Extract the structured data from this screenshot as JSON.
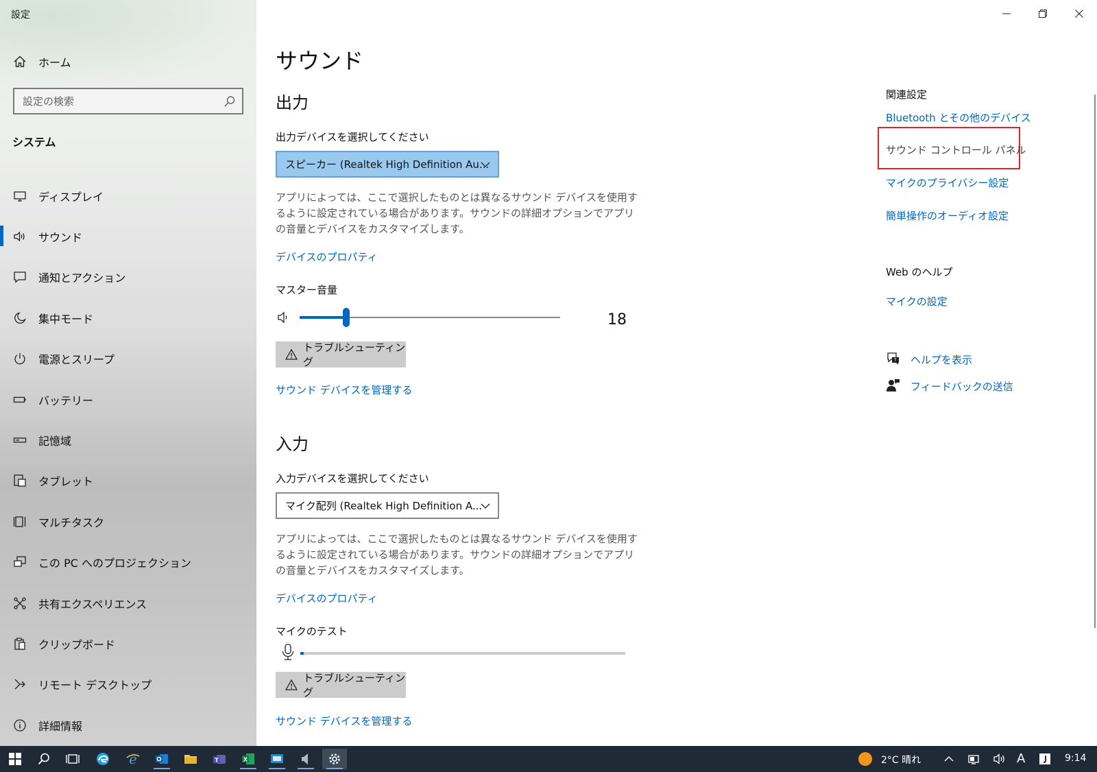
{
  "window": {
    "title": "設定"
  },
  "sidebar": {
    "home_label": "ホーム",
    "search_placeholder": "設定の検索",
    "section_title": "システム",
    "items": [
      {
        "label": "ディスプレイ",
        "icon": "display-icon"
      },
      {
        "label": "サウンド",
        "icon": "speaker-icon",
        "active": true
      },
      {
        "label": "通知とアクション",
        "icon": "notification-icon"
      },
      {
        "label": "集中モード",
        "icon": "moon-icon"
      },
      {
        "label": "電源とスリープ",
        "icon": "power-icon"
      },
      {
        "label": "バッテリー",
        "icon": "battery-icon"
      },
      {
        "label": "記憶域",
        "icon": "storage-icon"
      },
      {
        "label": "タブレット",
        "icon": "tablet-icon"
      },
      {
        "label": "マルチタスク",
        "icon": "multitask-icon"
      },
      {
        "label": "この PC へのプロジェクション",
        "icon": "projection-icon"
      },
      {
        "label": "共有エクスペリエンス",
        "icon": "share-icon"
      },
      {
        "label": "クリップボード",
        "icon": "clipboard-icon"
      },
      {
        "label": "リモート デスクトップ",
        "icon": "remote-desktop-icon"
      },
      {
        "label": "詳細情報",
        "icon": "info-icon"
      }
    ]
  },
  "main": {
    "title": "サウンド",
    "output": {
      "heading": "出力",
      "device_label": "出力デバイスを選択してください",
      "device_value": "スピーカー (Realtek High Definition Au...",
      "description": "アプリによっては、ここで選択したものとは異なるサウンド デバイスを使用するように設定されている場合があります。サウンドの詳細オプションでアプリの音量とデバイスをカスタマイズします。",
      "properties_link": "デバイスのプロパティ",
      "master_volume_label": "マスター音量",
      "volume_value": "18",
      "volume_fraction": 0.18,
      "troubleshoot_label": "トラブルシューティング",
      "manage_link": "サウンド デバイスを管理する"
    },
    "input": {
      "heading": "入力",
      "device_label": "入力デバイスを選択してください",
      "device_value": "マイク配列 (Realtek High Definition A...",
      "description": "アプリによっては、ここで選択したものとは異なるサウンド デバイスを使用するように設定されている場合があります。サウンドの詳細オプションでアプリの音量とデバイスをカスタマイズします。",
      "properties_link": "デバイスのプロパティ",
      "mic_test_label": "マイクのテスト",
      "mic_level_fraction": 0.01,
      "troubleshoot_label": "トラブルシューティング",
      "manage_link": "サウンド デバイスを管理する"
    }
  },
  "related": {
    "heading": "関連設定",
    "links": {
      "bluetooth": "Bluetooth とその他のデバイス",
      "sound_control_panel": "サウンド コントロール パネル",
      "mic_privacy": "マイクのプライバシー設定",
      "ease_audio": "簡単操作のオーディオ設定"
    },
    "web_help_heading": "Web のヘルプ",
    "mic_settings_link": "マイクの設定",
    "help_link": "ヘルプを表示",
    "feedback_link": "フィードバックの送信"
  },
  "taskbar": {
    "weather": "2°C 晴れ",
    "ime": "A",
    "time": "9:14"
  },
  "colors": {
    "accent": "#0067c0",
    "highlight_box": "#e0242c",
    "dropdown_selected": "#99c9ef",
    "taskbar": "#1f2a36"
  }
}
